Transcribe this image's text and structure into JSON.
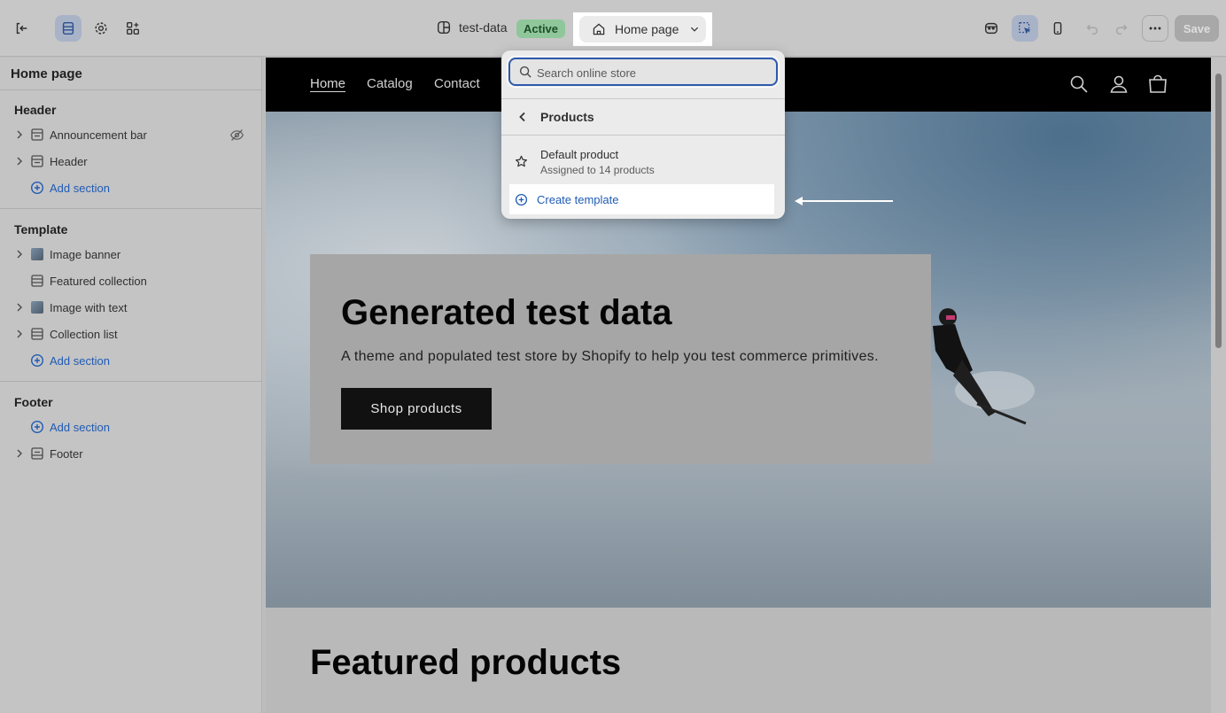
{
  "topbar": {
    "theme_name": "test-data",
    "theme_status": "Active",
    "page_selector": "Home page",
    "save_label": "Save",
    "icons": [
      "exit-icon",
      "sections-icon",
      "settings-icon",
      "apps-icon",
      "inspector-icon",
      "select-icon",
      "mobile-icon",
      "undo-icon",
      "redo-icon",
      "more-icon"
    ]
  },
  "sidebar": {
    "title": "Home page",
    "groups": [
      {
        "label": "Header",
        "items": [
          {
            "label": "Announcement bar",
            "hidden": true
          },
          {
            "label": "Header"
          }
        ],
        "add_label": "Add section"
      },
      {
        "label": "Template",
        "items": [
          {
            "label": "Image banner"
          },
          {
            "label": "Featured collection"
          },
          {
            "label": "Image with text"
          },
          {
            "label": "Collection list"
          }
        ],
        "add_label": "Add section"
      },
      {
        "label": "Footer",
        "items": [
          {
            "label": "Footer"
          }
        ],
        "add_label": "Add section"
      }
    ]
  },
  "preview": {
    "nav": [
      "Home",
      "Catalog",
      "Contact"
    ],
    "hero": {
      "title": "Generated test data",
      "subtitle": "A theme and populated test store by Shopify to help you test commerce primitives.",
      "button": "Shop products"
    },
    "featured_title": "Featured products"
  },
  "dropdown": {
    "search_placeholder": "Search online store",
    "back_label": "Products",
    "template": {
      "name": "Default product",
      "meta": "Assigned to 14 products"
    },
    "create_label": "Create template"
  },
  "colors": {
    "accent_blue": "#1f5bb5",
    "active_badge": "#8fc79a"
  }
}
